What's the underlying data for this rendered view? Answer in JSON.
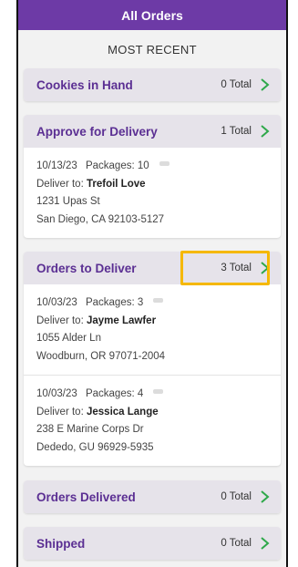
{
  "header": {
    "title": "All Orders"
  },
  "filter": {
    "label": "MOST RECENT"
  },
  "sections": {
    "cookies_in_hand": {
      "title": "Cookies in Hand",
      "total": "0 Total"
    },
    "approve_for_delivery": {
      "title": "Approve for Delivery",
      "total": "1 Total",
      "orders": [
        {
          "date": "10/13/23",
          "packages": "Packages: 10",
          "deliver_prefix": "Deliver to:",
          "name": "Trefoil Love",
          "street": "1231 Upas St",
          "city": "San Diego, CA 92103-5127"
        }
      ]
    },
    "orders_to_deliver": {
      "title": "Orders to Deliver",
      "total": "3 Total",
      "orders": [
        {
          "date": "10/03/23",
          "packages": "Packages: 3",
          "deliver_prefix": "Deliver to:",
          "name": "Jayme Lawfer",
          "street": "1055 Alder Ln",
          "city": "Woodburn, OR 97071-2004"
        },
        {
          "date": "10/03/23",
          "packages": "Packages: 4",
          "deliver_prefix": "Deliver to:",
          "name": "Jessica Lange",
          "street": "238 E Marine Corps Dr",
          "city": "Dededo, GU 96929-5935"
        }
      ]
    },
    "orders_delivered": {
      "title": "Orders Delivered",
      "total": "0 Total"
    },
    "shipped": {
      "title": "Shipped",
      "total": "0 Total"
    }
  },
  "icons": {
    "chevron": "chevron-right-icon"
  },
  "colors": {
    "brand": "#6d3aa6",
    "accent": "#5b2f93",
    "chevron": "#2ea84a",
    "highlight": "#f5b800"
  }
}
